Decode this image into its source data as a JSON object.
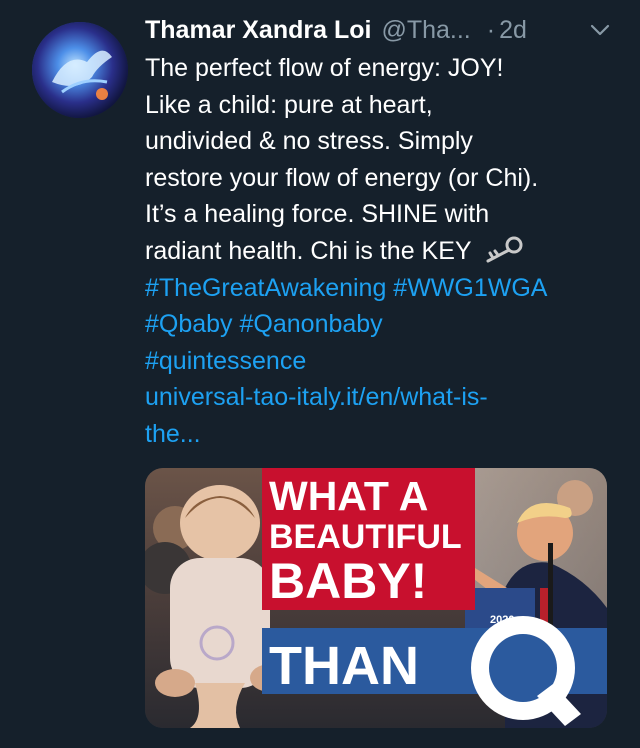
{
  "tweet": {
    "name": "Thamar Xandra Loi",
    "handle": "@Tha...",
    "dot": "·",
    "time": "2d",
    "lines": [
      "The perfect flow of energy: JOY!",
      "Like a child: pure at heart,",
      "undivided & no stress. Simply",
      "restore your flow of energy (or Chi).",
      "It’s a healing force. SHINE with",
      "radiant health. Chi is the KEY"
    ],
    "hashtags_line1": "#TheGreatAwakening #WWG1WGA",
    "hashtags_line2": "#Qbaby #Qanonbaby",
    "hashtags_line3": "#quintessence",
    "url_line1": "universal-tao-italy.it/en/what-is-",
    "url_line2": "the..."
  },
  "media": {
    "line1": "WHAT A",
    "line2": "BEAUTIFUL",
    "line3": "BABY!",
    "line4": "THAN",
    "q_letter": "Q",
    "podium_year": "2020"
  },
  "colors": {
    "background": "#15202b",
    "link": "#1da1f2",
    "muted": "#8899a6",
    "banner_red": "#c8102e",
    "banner_blue": "#2b5a9e"
  },
  "icons": {
    "menu": "chevron-down-icon",
    "key": "key-emoji-icon"
  }
}
